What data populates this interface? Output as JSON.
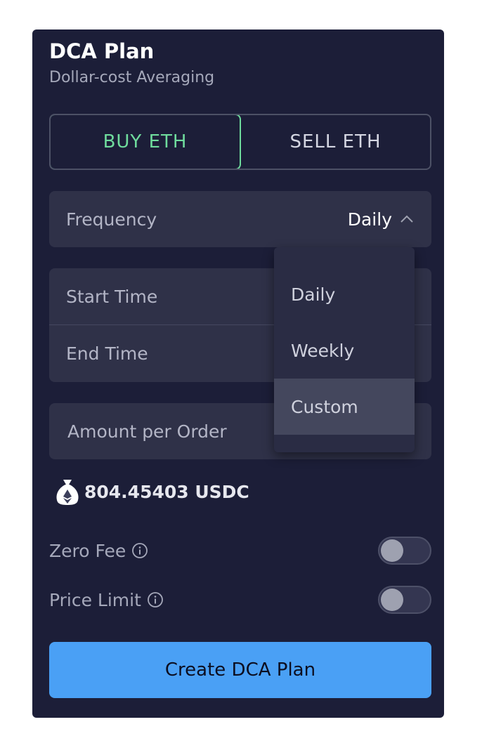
{
  "header": {
    "title": "DCA Plan",
    "subtitle": "Dollar-cost Averaging"
  },
  "side_toggle": {
    "buy_label": "BUY ETH",
    "sell_label": "SELL ETH",
    "selected": "buy"
  },
  "frequency": {
    "label": "Frequency",
    "value": "Daily",
    "dropdown_open": true,
    "options": [
      "Daily",
      "Weekly",
      "Custom"
    ],
    "hovered_option": "Custom"
  },
  "time_range": {
    "start_label": "Start Time",
    "end_label": "End Time"
  },
  "amount": {
    "label": "Amount per Order"
  },
  "balance": {
    "value": "804.45403 USDC",
    "icon": "money-bag-eth-icon"
  },
  "options": {
    "zero_fee": {
      "label": "Zero Fee",
      "enabled": false
    },
    "price_limit": {
      "label": "Price Limit",
      "enabled": false
    }
  },
  "actions": {
    "create_label": "Create DCA Plan"
  },
  "colors": {
    "panel_bg": "#1c1e38",
    "field_bg": "#2f3148",
    "buy_accent": "#6fdc9d",
    "primary_button": "#4aa0f5"
  }
}
